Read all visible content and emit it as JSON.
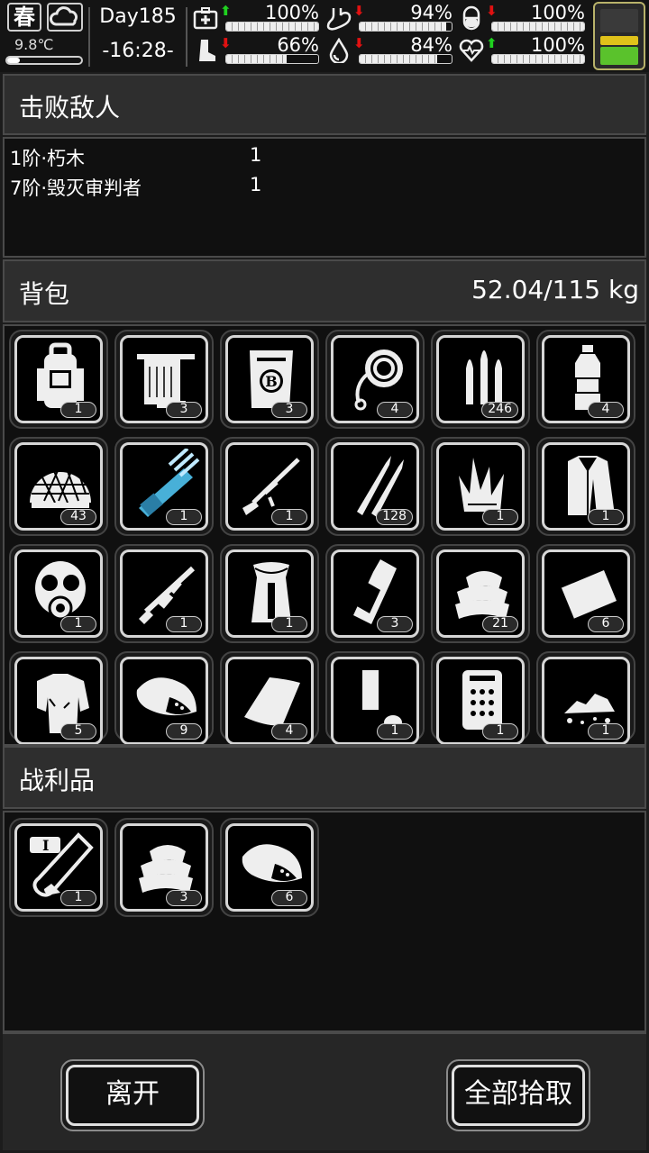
{
  "status": {
    "season": "春",
    "weather_icon": "cloud-icon",
    "temperature": "9.8℃",
    "day": "Day185",
    "time": "-16:28-",
    "stats": [
      {
        "icon": "medkit-icon",
        "trend": "up",
        "value": "100%",
        "level": 1.0
      },
      {
        "icon": "stomach-icon",
        "trend": "down",
        "value": "94%",
        "level": 0.94
      },
      {
        "icon": "pill-icon",
        "trend": "down",
        "value": "100%",
        "level": 1.0
      },
      {
        "icon": "foot-icon",
        "trend": "down",
        "value": "66%",
        "level": 0.66
      },
      {
        "icon": "water-drop-icon",
        "trend": "down",
        "value": "84%",
        "level": 0.84
      },
      {
        "icon": "heart-icon",
        "trend": "up",
        "value": "100%",
        "level": 1.0
      }
    ],
    "arrows": {
      "up": "⬆",
      "down": "⬇"
    },
    "colors": {
      "up": "#1fd11f",
      "down": "#e11111"
    }
  },
  "defeated": {
    "title": "击败敌人",
    "enemies": [
      {
        "name": "1阶·朽木",
        "count": "1"
      },
      {
        "name": "7阶·毁灭审判者",
        "count": "1"
      }
    ]
  },
  "backpack": {
    "title": "背包",
    "weight": "52.04/115 kg",
    "items": [
      {
        "icon": "backpack-icon",
        "count": "1"
      },
      {
        "icon": "towel-icon",
        "count": "3"
      },
      {
        "icon": "bag-icon",
        "count": "3"
      },
      {
        "icon": "rope-icon",
        "count": "4"
      },
      {
        "icon": "bullets-icon",
        "count": "246"
      },
      {
        "icon": "water-bottle-icon",
        "count": "4"
      },
      {
        "icon": "helmet-icon",
        "count": "43"
      },
      {
        "icon": "minigun-icon",
        "count": "1"
      },
      {
        "icon": "sniper-rifle-icon",
        "count": "1"
      },
      {
        "icon": "rifle-rounds-icon",
        "count": "128"
      },
      {
        "icon": "grass-icon",
        "count": "1"
      },
      {
        "icon": "fur-coat-icon",
        "count": "1"
      },
      {
        "icon": "gas-mask-icon",
        "count": "1"
      },
      {
        "icon": "assault-rifle-icon",
        "count": "1"
      },
      {
        "icon": "fur-cloak-icon",
        "count": "1"
      },
      {
        "icon": "milk-carton-icon",
        "count": "3"
      },
      {
        "icon": "cloth-pile-icon",
        "count": "21"
      },
      {
        "icon": "paper-icon",
        "count": "6"
      },
      {
        "icon": "ragged-shirt-icon",
        "count": "5"
      },
      {
        "icon": "meat-icon",
        "count": "9"
      },
      {
        "icon": "blanket-icon",
        "count": "4"
      },
      {
        "icon": "paint-kit-icon",
        "count": "1"
      },
      {
        "icon": "circuit-board-icon",
        "count": "1"
      },
      {
        "icon": "rubble-icon",
        "count": "1"
      }
    ]
  },
  "loot": {
    "title": "战利品",
    "items": [
      {
        "icon": "vial-icon",
        "count": "1"
      },
      {
        "icon": "cloth-pile-icon",
        "count": "3"
      },
      {
        "icon": "meat-icon",
        "count": "6"
      }
    ]
  },
  "buttons": {
    "leave": "离开",
    "take_all": "全部拾取"
  }
}
